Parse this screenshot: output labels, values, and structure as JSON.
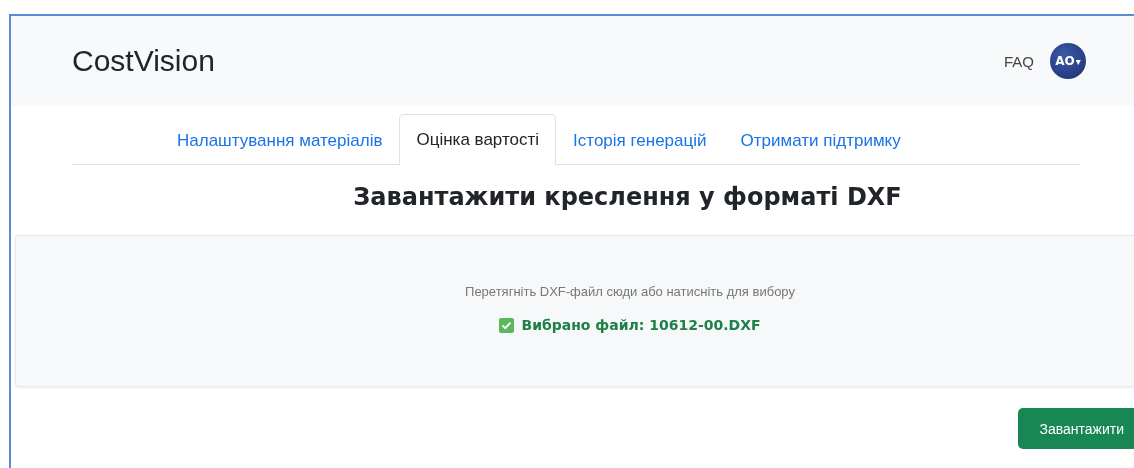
{
  "navbar": {
    "brand": "CostVision",
    "links": [
      "FAQ"
    ],
    "avatar": {
      "initials": "AO",
      "menu_caret": "▾"
    }
  },
  "tabs": [
    {
      "label": "Налаштування матеріалів",
      "selected": false
    },
    {
      "label": "Оцінка вартості",
      "selected": true
    },
    {
      "label": "Історія генерацій",
      "selected": false
    },
    {
      "label": "Отримати підтримку",
      "selected": false
    }
  ],
  "heading": "Завантажити креслення у форматі DXF",
  "dropzone": {
    "hint": "Перетягніть DXF-файл сюди або натисніть для вибору",
    "file_selected": true,
    "file_label": "Вибрано файл: 10612-00.DXF"
  },
  "upload_button": "Завантажити"
}
